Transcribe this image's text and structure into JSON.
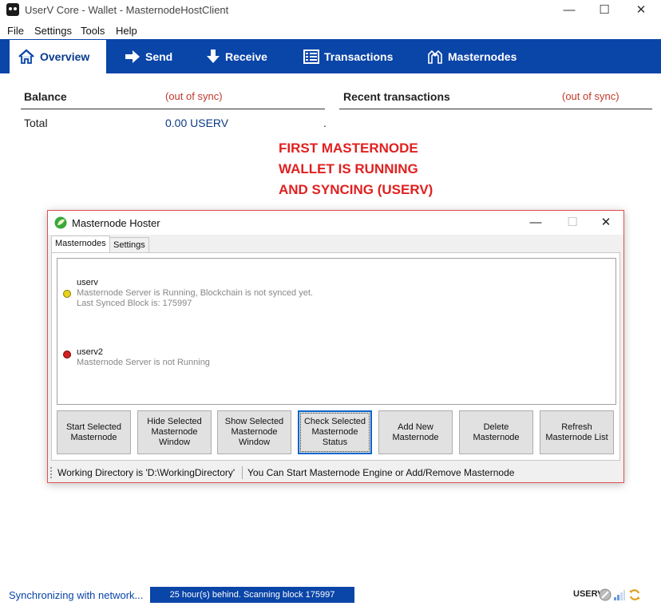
{
  "window": {
    "title": "UserV Core - Wallet - MasternodeHostClient",
    "minimize": "—",
    "maximize": "☐",
    "close": "✕"
  },
  "menu": [
    "File",
    "Settings",
    "Tools",
    "Help"
  ],
  "tabs": [
    {
      "label": "Overview",
      "icon": "home-icon"
    },
    {
      "label": "Send",
      "icon": "send-arrow-icon"
    },
    {
      "label": "Receive",
      "icon": "receive-arrow-icon"
    },
    {
      "label": "Transactions",
      "icon": "list-icon"
    },
    {
      "label": "Masternodes",
      "icon": "masternode-icon"
    }
  ],
  "overview": {
    "balance_heading": "Balance",
    "balance_sync": "(out of sync)",
    "recent_heading": "Recent transactions",
    "recent_sync": "(out of sync)",
    "total_label": "Total",
    "total_value": "0.00 USERV",
    "dot": "."
  },
  "annotation": [
    "FIRST MASTERNODE",
    "WALLET IS RUNNING",
    "AND SYNCING (USERV)"
  ],
  "dialog": {
    "title": "Masternode Hoster",
    "minimize": "—",
    "maximize": "☐",
    "close": "✕",
    "tabs": [
      "Masternodes",
      "Settings"
    ],
    "masternodes": [
      {
        "name": "userv",
        "status_color": "#e8d21a",
        "lines": [
          "Masternode Server is Running, Blockchain is not synced yet.",
          "Last Synced Block is: 175997"
        ]
      },
      {
        "name": "userv2",
        "status_color": "#d22020",
        "lines": [
          "Masternode Server is not Running"
        ]
      }
    ],
    "buttons": [
      "Start Selected Masternode",
      "Hide Selected Masternode Window",
      "Show Selected Masternode Window",
      "Check Selected Masternode Status",
      "Add New Masternode",
      "Delete Masternode",
      "Refresh Masternode List"
    ],
    "status_working_dir": "Working Directory is 'D:\\WorkingDirectory'",
    "status_hint": "You Can Start Masternode Engine or Add/Remove Masternode"
  },
  "statusbar": {
    "sync_text": "Synchronizing with network...",
    "progress_text": "25 hour(s) behind. Scanning block 175997",
    "unit": "USERV"
  },
  "colors": {
    "brand_blue": "#0a45a8",
    "out_of_sync": "#c0392b",
    "annotation_red": "#e02020"
  }
}
